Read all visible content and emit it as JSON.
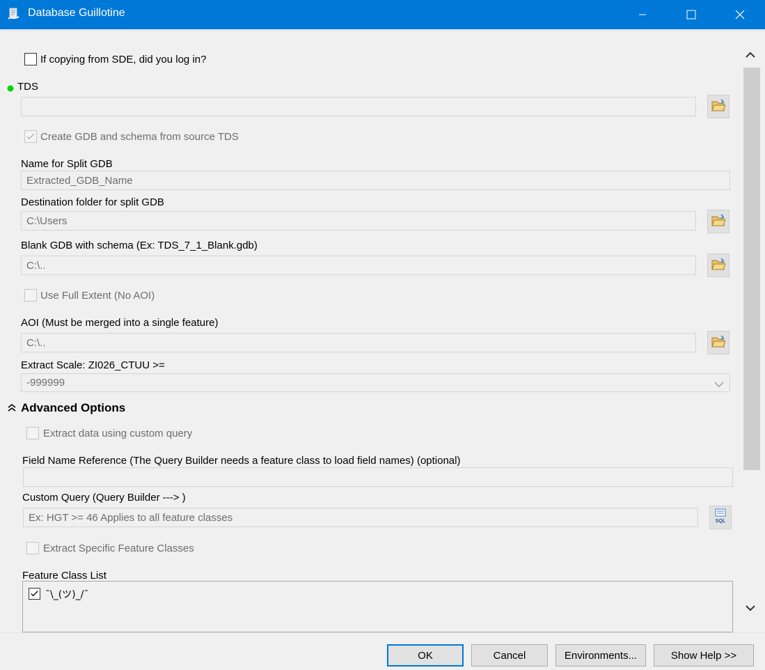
{
  "window": {
    "title": "Database Guillotine",
    "app_icon": "geoprocessing-tool-icon",
    "minimize_icon": "minimize-icon",
    "maximize_icon": "maximize-icon",
    "close_icon": "close-icon",
    "title_bar_color": "#0078d7"
  },
  "form": {
    "sde_login": {
      "label": "If copying from SDE, did you log in?",
      "checked": false
    },
    "tds": {
      "label": "TDS",
      "value": "",
      "required_indicator": "green-dot-icon"
    },
    "create_gdb": {
      "label": "Create GDB and schema from source TDS",
      "checked": true,
      "enabled": false
    },
    "split_gdb_name": {
      "label": "Name for Split GDB",
      "value": "Extracted_GDB_Name"
    },
    "dest_folder": {
      "label": "Destination folder for split GDB",
      "value": "C:\\Users"
    },
    "blank_gdb": {
      "label": "Blank GDB with schema (Ex: TDS_7_1_Blank.gdb)",
      "value": "C:\\.."
    },
    "full_extent": {
      "label": "Use Full Extent (No AOI)",
      "checked": false,
      "enabled": false
    },
    "aoi": {
      "label": "AOI (Must be merged into a single feature)",
      "value": "C:\\.."
    },
    "extract_scale": {
      "label": "Extract Scale: ZI026_CTUU >=",
      "value": "-999999"
    },
    "advanced": {
      "title": "Advanced Options",
      "custom_query_chk": {
        "label": "Extract data using custom query",
        "checked": false,
        "enabled": false
      },
      "field_name_ref": {
        "label": "Field Name Reference (The Query Builder needs a feature class to load field names) (optional)",
        "value": ""
      },
      "custom_query": {
        "label": "Custom Query (Query Builder ---> )",
        "value": "Ex: HGT >= 46   Applies to all feature classes",
        "sql_button": "SQL"
      },
      "specific_fc_chk": {
        "label": "Extract Specific Feature Classes",
        "checked": false,
        "enabled": false
      },
      "feature_class_list": {
        "label": "Feature Class List",
        "items": [
          {
            "label": "¯\\_(ツ)_/¯",
            "checked": true
          }
        ]
      }
    }
  },
  "buttons": {
    "ok": "OK",
    "cancel": "Cancel",
    "environments": "Environments...",
    "show_help": "Show Help >>"
  }
}
